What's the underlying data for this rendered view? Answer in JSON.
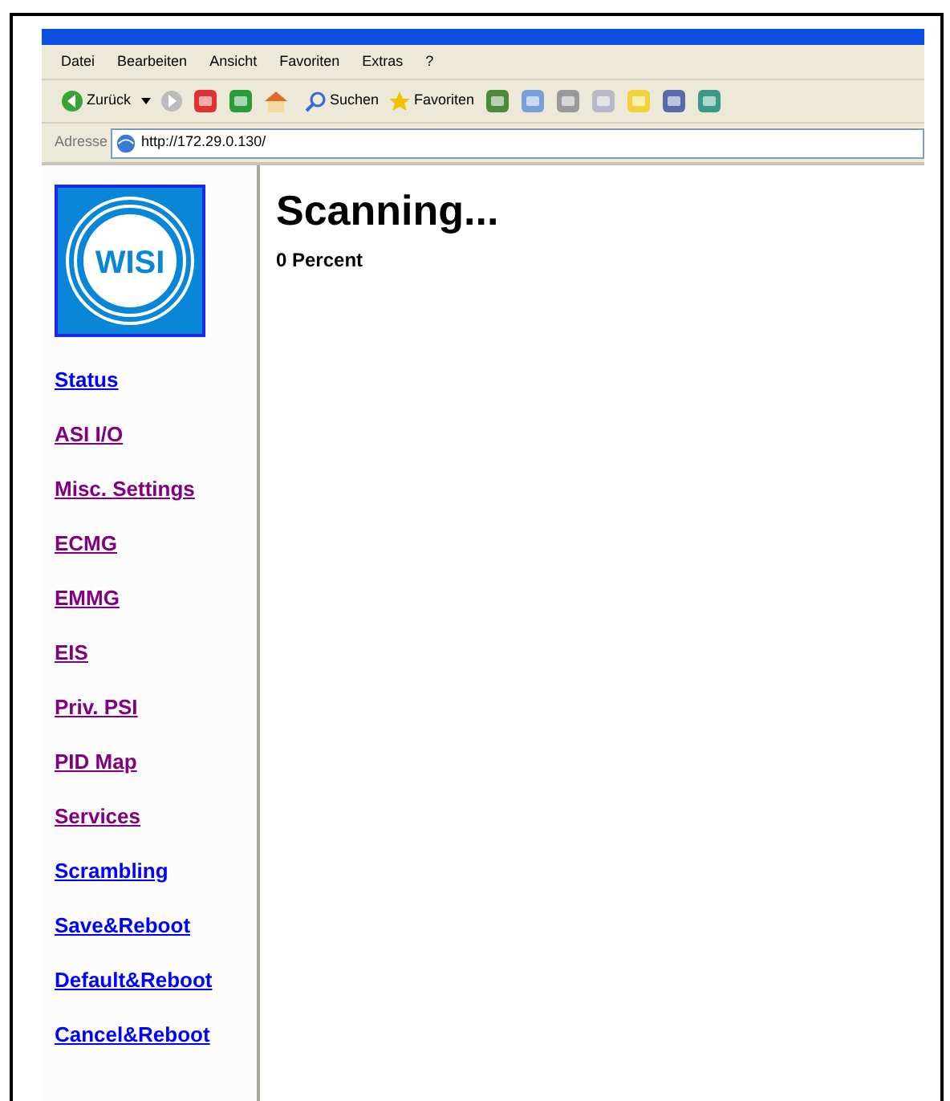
{
  "menu": [
    "Datei",
    "Bearbeiten",
    "Ansicht",
    "Favoriten",
    "Extras",
    "?"
  ],
  "toolbar": {
    "back": "Zurück",
    "search": "Suchen",
    "favorites": "Favoriten"
  },
  "address": {
    "label": "Adresse",
    "value": "http://172.29.0.130/"
  },
  "sidebar": {
    "logo": "WISI",
    "items": [
      {
        "label": "Status",
        "visited": false
      },
      {
        "label": "ASI I/O",
        "visited": true
      },
      {
        "label": "Misc. Settings",
        "visited": true
      },
      {
        "label": "ECMG",
        "visited": true
      },
      {
        "label": "EMMG",
        "visited": true
      },
      {
        "label": "EIS",
        "visited": true
      },
      {
        "label": "Priv. PSI",
        "visited": true
      },
      {
        "label": "PID Map",
        "visited": true
      },
      {
        "label": "Services",
        "visited": true
      },
      {
        "label": "Scrambling",
        "visited": false
      },
      {
        "label": "Save&Reboot",
        "visited": false
      },
      {
        "label": "Default&Reboot",
        "visited": false
      },
      {
        "label": "Cancel&Reboot",
        "visited": false
      }
    ]
  },
  "main": {
    "heading": "Scanning...",
    "progress": "0 Percent"
  }
}
